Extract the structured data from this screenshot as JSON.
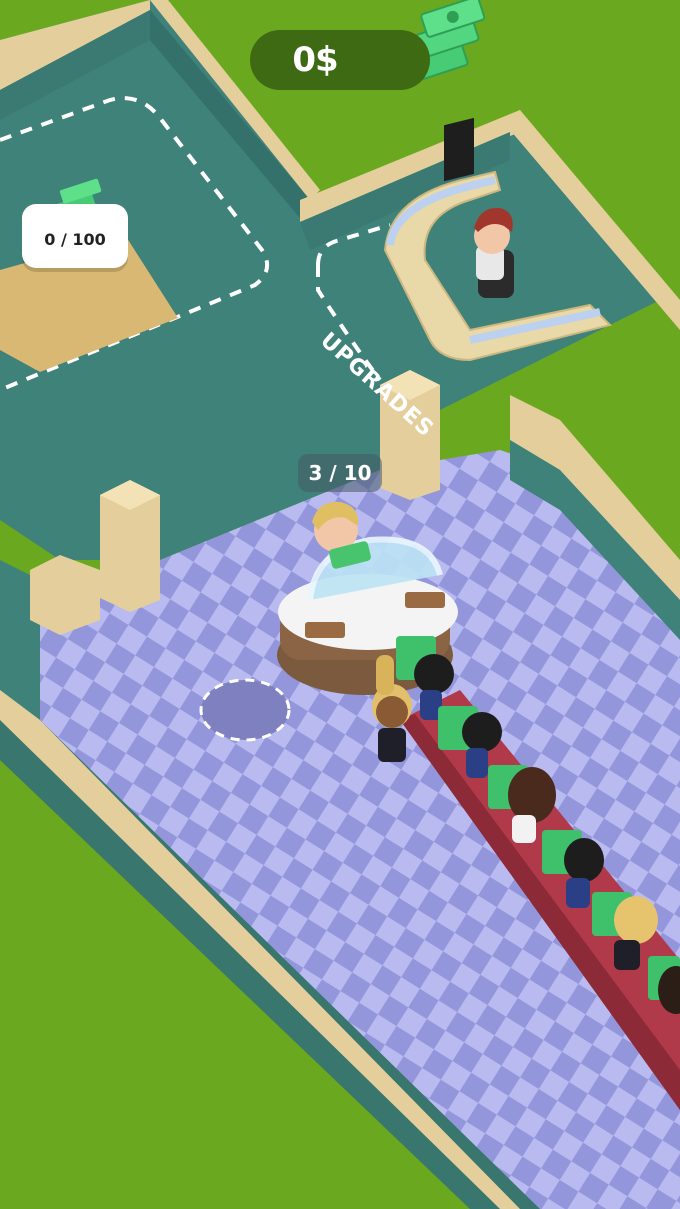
{
  "hud": {
    "money": "0$",
    "money_icon": "cash-stack-icon"
  },
  "storage": {
    "capacity_label": "0 / 100",
    "icon": "cash-stack-icon"
  },
  "counter": {
    "queue_label": "3 / 10"
  },
  "upgrades_zone": {
    "label": "UPGRADES"
  },
  "colors": {
    "grass": "#6aa81f",
    "floor_teal": "#3f8279",
    "wall_cream": "#e8d3a0",
    "tile_light": "#b6b8ef",
    "tile_dark": "#8e90d8",
    "carpet": "#b33a4a",
    "cash_green": "#4fd37a"
  }
}
